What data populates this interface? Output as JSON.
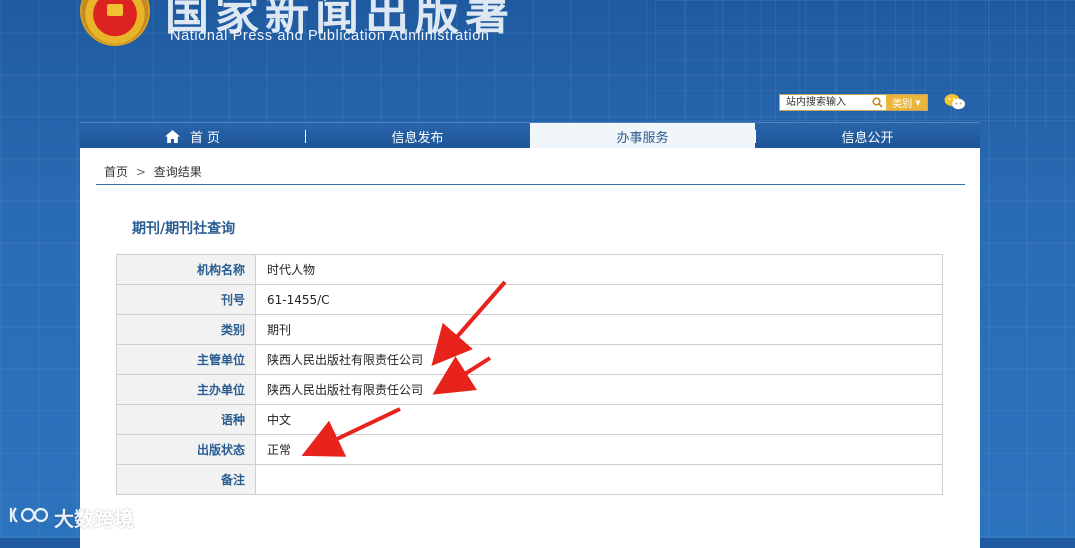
{
  "header": {
    "title_cn": "国家新闻出版署",
    "title_en": "National  Press and Publication Administration"
  },
  "search": {
    "placeholder": "站内搜索输入",
    "category_label": "类别"
  },
  "nav": {
    "items": [
      {
        "label": "首 页",
        "icon": "home-icon"
      },
      {
        "label": "信息发布"
      },
      {
        "label": "办事服务",
        "active": true
      },
      {
        "label": "信息公开"
      }
    ]
  },
  "breadcrumb": {
    "home": "首页",
    "separator": ">",
    "current": "查询结果"
  },
  "page_title": "期刊/期刊社查询",
  "table": {
    "rows": [
      {
        "label": "机构名称",
        "value": "时代人物"
      },
      {
        "label": "刊号",
        "value": "61-1455/C"
      },
      {
        "label": "类别",
        "value": "期刊"
      },
      {
        "label": "主管单位",
        "value": "陕西人民出版社有限责任公司"
      },
      {
        "label": "主办单位",
        "value": "陕西人民出版社有限责任公司"
      },
      {
        "label": "语种",
        "value": "中文"
      },
      {
        "label": "出版状态",
        "value": "正常"
      },
      {
        "label": "备注",
        "value": ""
      }
    ]
  },
  "watermark": {
    "text": "大数跨境"
  },
  "colors": {
    "accent_blue": "#2a5d93",
    "arrow_red": "#e8231b",
    "category_gold": "#e9b53c"
  }
}
